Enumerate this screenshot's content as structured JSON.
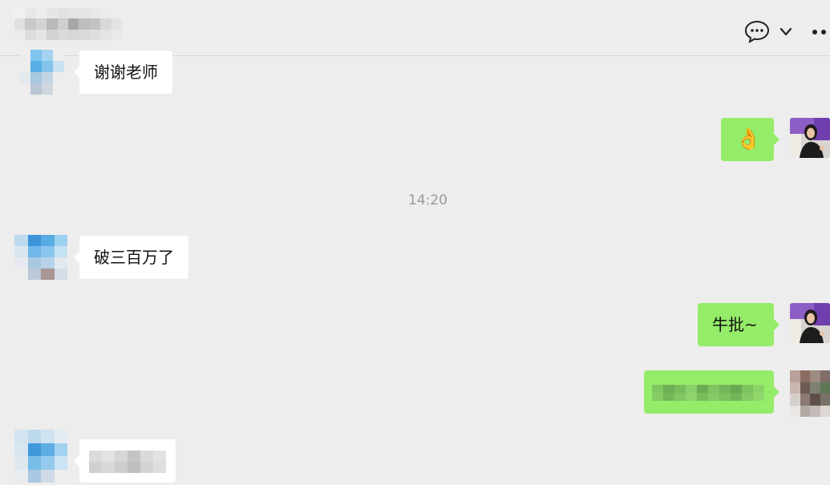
{
  "header": {
    "title_pixelated": true,
    "icons": [
      "chat-bubble-icon",
      "chevron-down-icon",
      "more-icon"
    ]
  },
  "messages": [
    {
      "side": "left",
      "text": "谢谢老师"
    },
    {
      "side": "right",
      "emoji": "👌"
    },
    {
      "type": "time",
      "text": "14:20"
    },
    {
      "side": "left",
      "text": "破三百万了"
    },
    {
      "side": "right",
      "text": "牛批~"
    },
    {
      "side": "right",
      "text_pixelated": true
    },
    {
      "side": "left",
      "text_pixelated": true
    }
  ],
  "colors": {
    "background": "#ededed",
    "bubble_self": "#95ec69",
    "bubble_other": "#ffffff",
    "timestamp": "#9a9a9a"
  }
}
